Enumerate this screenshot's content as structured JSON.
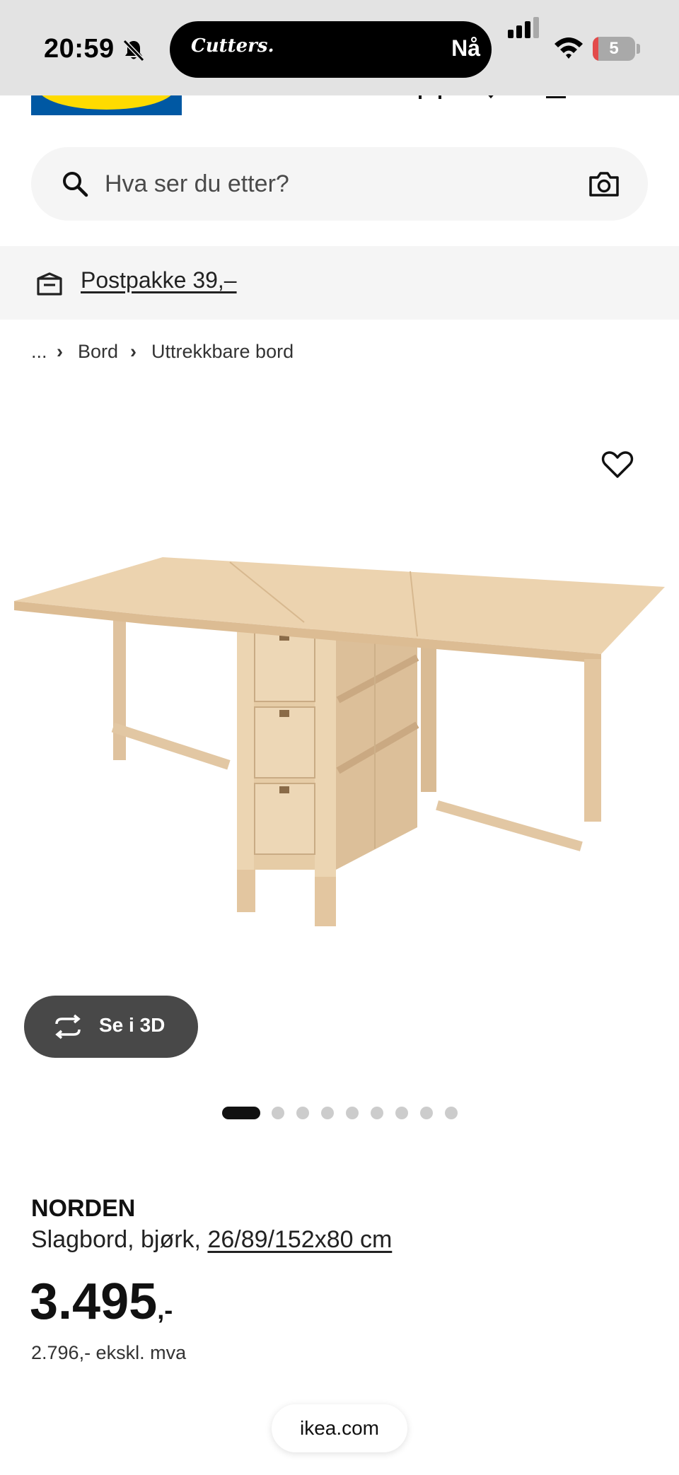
{
  "status_bar": {
    "time": "20:59",
    "island_app": "Cutters.",
    "island_status": "Nå",
    "battery_level": "5",
    "signal_bars": 3,
    "signal_bars_total": 4
  },
  "search": {
    "placeholder": "Hva ser du etter?"
  },
  "banner": {
    "link_text": "Postpakke 39,–"
  },
  "breadcrumb": {
    "ellipsis": "...",
    "separator": "›",
    "items": [
      "Bord",
      "Uttrekkbare bord"
    ]
  },
  "media": {
    "view_3d_label": "Se i 3D",
    "carousel_total": 9,
    "carousel_active_index": 0
  },
  "product": {
    "name": "NORDEN",
    "description_prefix": "Slagbord, bjørk,",
    "size": "26/89/152x80 cm",
    "price_main": "3.495",
    "price_suffix": ",-",
    "price_ex_vat": "2.796,- ekskl. mva"
  },
  "browser": {
    "url": "ikea.com"
  },
  "colors": {
    "ikea_blue": "#0058a3",
    "ikea_yellow": "#ffdb00",
    "status_bar_bg": "#e3e3e3",
    "search_bg": "#f5f5f5",
    "button_dark": "#484848",
    "wood": "#ead2b0"
  },
  "icons": [
    "bell-muted-icon",
    "cellular-signal-icon",
    "wifi-icon",
    "battery-icon",
    "search-icon",
    "camera-icon",
    "parcel-box-icon",
    "heart-icon",
    "rotate-3d-icon"
  ]
}
